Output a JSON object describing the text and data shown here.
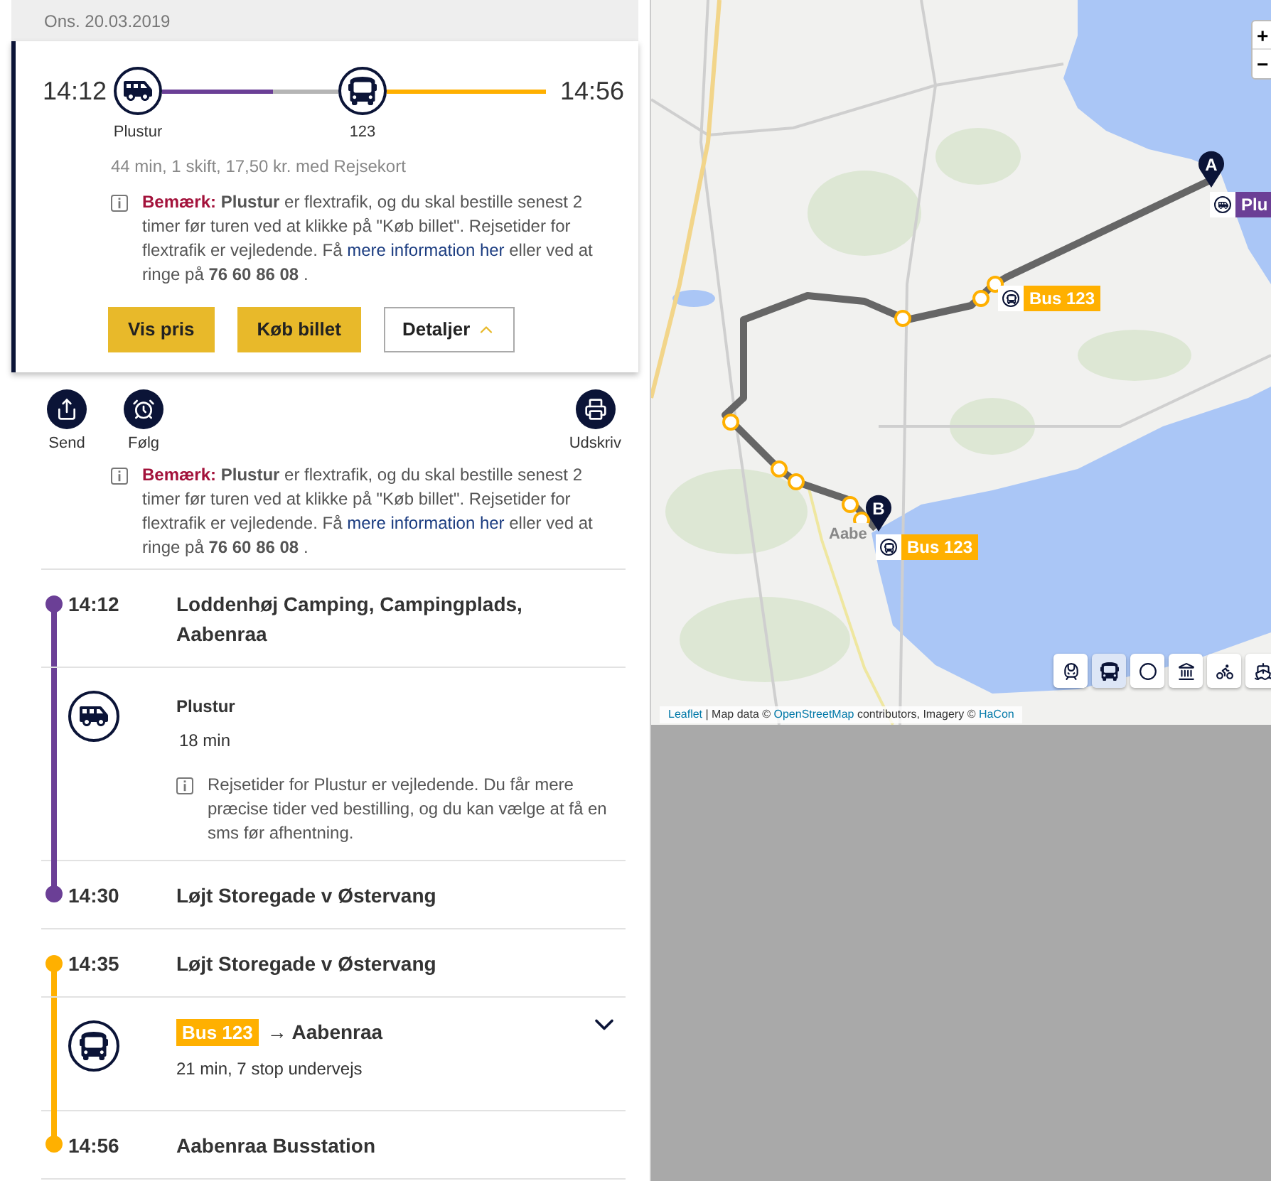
{
  "date": "Ons. 20.03.2019",
  "trip": {
    "depart": "14:12",
    "arrive": "14:56",
    "legs": [
      {
        "kind": "flex",
        "label": "Plustur",
        "color": "#6b3f96"
      },
      {
        "kind": "bus",
        "label": "123",
        "color": "#ffb000"
      }
    ],
    "summary": "44 min, 1 skift, 17,50 kr. med Rejsekort",
    "note": {
      "label": "Bemærk:",
      "before": "**Plustur** er flextrafik, og du skal bestille senest 2 timer før turen ved at klikke på \"Køb billet\". Rejsetider for flextrafik er vejledende. Få ",
      "link": "mere information her",
      "after": " eller ved at ringe på **76 60 86 08** ."
    },
    "buttons": [
      {
        "label": "Vis pris",
        "kind": "primary"
      },
      {
        "label": "Køb billet",
        "kind": "primary"
      },
      {
        "label": "Detaljer",
        "kind": "toggle",
        "expanded": true
      }
    ]
  },
  "actions": [
    {
      "label": "Send",
      "kind": "share"
    },
    {
      "label": "Følg",
      "kind": "alarm"
    },
    {
      "label": "Udskriv",
      "kind": "print"
    }
  ],
  "note": {
    "label": "Bemærk:",
    "before": "**Plustur** er flextrafik, og du skal bestille senest 2 timer før turen ved at klikke på \"Køb billet\". Rejsetider for flextrafik er vejledende. Få ",
    "link": "mere information her",
    "after": " eller ved at ringe på **76 60 86 08** ."
  },
  "sections": [
    {
      "color": "#6b3f96",
      "from": {
        "time": "14:12",
        "name": "Loddenhøj Camping, Campingplads, Aabenraa"
      },
      "leg": {
        "kind": "flex",
        "title": "Plustur",
        "duration": "18 min",
        "info": "Rejsetider for Plustur er vejledende. Du får mere præcise tider ved bestilling, og du kan vælge at få en sms før afhentning."
      },
      "to": {
        "time": "14:30",
        "name": "Løjt Storegade v Østervang"
      }
    },
    {
      "color": "#ffb000",
      "from": {
        "time": "14:35",
        "name": "Løjt Storegade v Østervang"
      },
      "leg": {
        "kind": "bus",
        "badge": "Bus 123",
        "direction": "→ Aabenraa",
        "duration": "21 min, 7 stop undervejs",
        "expanded": false
      },
      "to": {
        "time": "14:56",
        "name": "Aabenraa Busstation"
      }
    }
  ],
  "map": {
    "zoom": [
      "+",
      "−"
    ],
    "town": "Aabe",
    "markers": [
      {
        "letter": "A",
        "label": "Plu",
        "kind": "flex",
        "color": "#6b3f96"
      },
      {
        "letter": "B",
        "label": "Bus 123",
        "kind": "bus",
        "color": "#ffb000"
      }
    ],
    "stop_label": {
      "label": "Bus 123",
      "kind": "bus",
      "color": "#ffb000"
    },
    "layers": [
      {
        "kind": "train",
        "selected": false
      },
      {
        "kind": "bus",
        "selected": true
      },
      {
        "kind": "stog",
        "selected": false
      },
      {
        "kind": "metro",
        "selected": false
      },
      {
        "kind": "bike",
        "selected": false
      },
      {
        "kind": "ferry",
        "selected": false
      }
    ],
    "attribution": {
      "link1": "Leaflet",
      "text1": " | Map data © ",
      "link2": "OpenStreetMap",
      "text2": " contributors, Imagery © ",
      "link3": "HaCon"
    }
  }
}
